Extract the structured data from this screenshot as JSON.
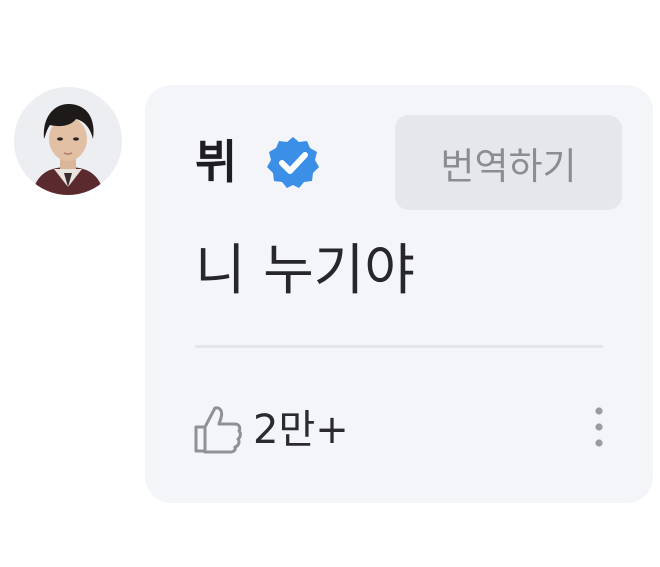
{
  "comment": {
    "author": "뷔",
    "verified": true,
    "text": "니 누기야",
    "translate_label": "번역하기",
    "likes": "2만+"
  },
  "icons": {
    "avatar": "profile-photo",
    "verified": "verified-badge-icon",
    "like": "thumbs-up-icon",
    "more": "vertical-ellipsis-icon"
  },
  "colors": {
    "card_background": "#f3f5f9",
    "verified_badge": "#3b8fe6",
    "translate_button": "#e6e7ea",
    "translate_text": "#8a8d93"
  }
}
